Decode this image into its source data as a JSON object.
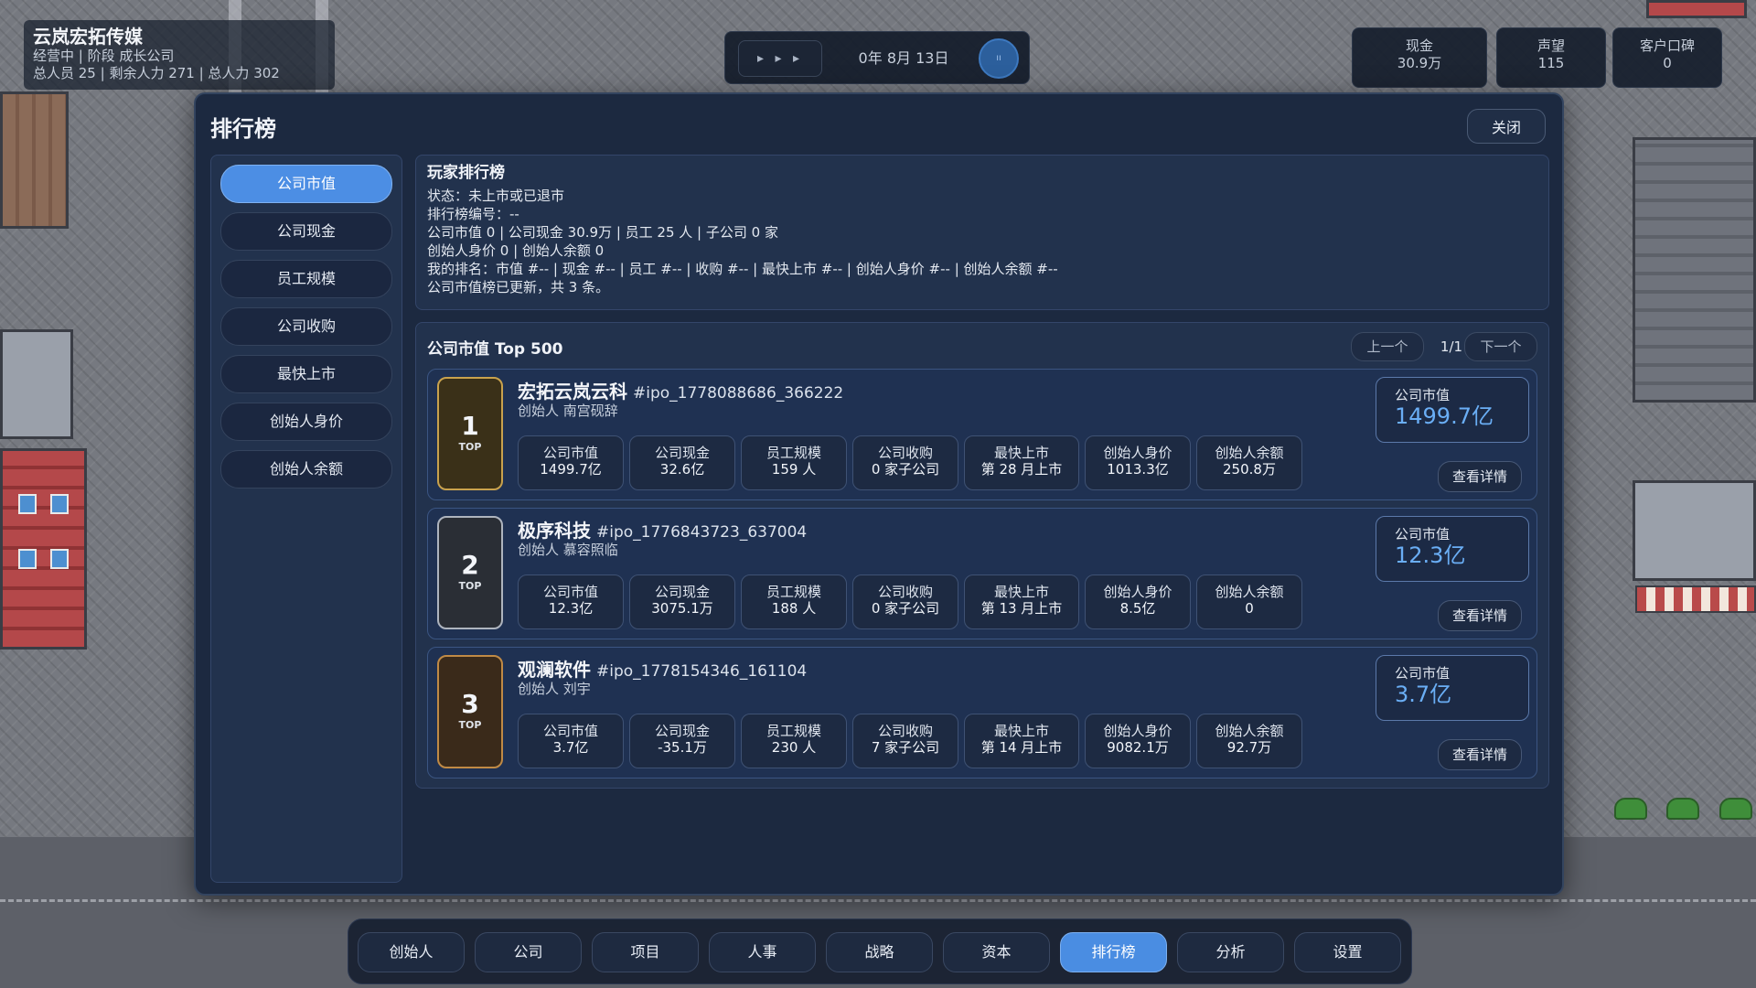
{
  "hud": {
    "company_name": "云岚宏拓传媒",
    "status_line": "经营中 | 阶段 成长公司",
    "staff_line": "总人员 25 | 剩余人力 271 | 总人力 302",
    "speed_label": "▸ ▸ ▸",
    "date": "0年 8月 13日",
    "pause_icon": "ıı",
    "stats": [
      {
        "label": "现金",
        "value": "30.9万"
      },
      {
        "label": "声望",
        "value": "115"
      },
      {
        "label": "客户口碑",
        "value": "0"
      }
    ]
  },
  "modal": {
    "title": "排行榜",
    "close_label": "关闭"
  },
  "sidebar": {
    "items": [
      {
        "label": "公司市值",
        "active": true
      },
      {
        "label": "公司现金",
        "active": false
      },
      {
        "label": "员工规模",
        "active": false
      },
      {
        "label": "公司收购",
        "active": false
      },
      {
        "label": "最快上市",
        "active": false
      },
      {
        "label": "创始人身价",
        "active": false
      },
      {
        "label": "创始人余额",
        "active": false
      }
    ]
  },
  "player_info": {
    "title": "玩家排行榜",
    "lines": [
      "状态：未上市或已退市",
      "排行榜编号：--",
      "公司市值 0 | 公司现金 30.9万 | 员工 25 人 | 子公司 0 家",
      "创始人身价 0 | 创始人余额 0",
      "我的排名：市值 #-- | 现金 #-- | 员工 #-- | 收购 #-- | 最快上市 #-- | 创始人身价 #-- | 创始人余额 #--",
      "公司市值榜已更新，共 3 条。"
    ]
  },
  "leaderboard": {
    "title": "公司市值 Top 500",
    "prev_label": "上一个",
    "page": "1/1",
    "next_label": "下一个",
    "top_label": "TOP",
    "market_value_label": "公司市值",
    "detail_label": "查看详情",
    "entries": [
      {
        "rank": "1",
        "name": "宏拓云岚云科",
        "id": "#ipo_1778088686_366222",
        "founder": "创始人 南宫砚辞",
        "market_value": "1499.7亿",
        "metrics": [
          {
            "label": "公司市值",
            "value": "1499.7亿"
          },
          {
            "label": "公司现金",
            "value": "32.6亿"
          },
          {
            "label": "员工规模",
            "value": "159 人"
          },
          {
            "label": "公司收购",
            "value": "0 家子公司"
          },
          {
            "label": "最快上市",
            "value": "第 28 月上市"
          },
          {
            "label": "创始人身价",
            "value": "1013.3亿"
          },
          {
            "label": "创始人余额",
            "value": "250.8万"
          }
        ]
      },
      {
        "rank": "2",
        "name": "极序科技",
        "id": "#ipo_1776843723_637004",
        "founder": "创始人 慕容照临",
        "market_value": "12.3亿",
        "metrics": [
          {
            "label": "公司市值",
            "value": "12.3亿"
          },
          {
            "label": "公司现金",
            "value": "3075.1万"
          },
          {
            "label": "员工规模",
            "value": "188 人"
          },
          {
            "label": "公司收购",
            "value": "0 家子公司"
          },
          {
            "label": "最快上市",
            "value": "第 13 月上市"
          },
          {
            "label": "创始人身价",
            "value": "8.5亿"
          },
          {
            "label": "创始人余额",
            "value": "0"
          }
        ]
      },
      {
        "rank": "3",
        "name": "观澜软件",
        "id": "#ipo_1778154346_161104",
        "founder": "创始人 刘宇",
        "market_value": "3.7亿",
        "metrics": [
          {
            "label": "公司市值",
            "value": "3.7亿"
          },
          {
            "label": "公司现金",
            "value": "-35.1万"
          },
          {
            "label": "员工规模",
            "value": "230 人"
          },
          {
            "label": "公司收购",
            "value": "7 家子公司"
          },
          {
            "label": "最快上市",
            "value": "第 14 月上市"
          },
          {
            "label": "创始人身价",
            "value": "9082.1万"
          },
          {
            "label": "创始人余额",
            "value": "92.7万"
          }
        ]
      }
    ]
  },
  "bottom_nav": {
    "items": [
      {
        "label": "创始人",
        "active": false
      },
      {
        "label": "公司",
        "active": false
      },
      {
        "label": "项目",
        "active": false
      },
      {
        "label": "人事",
        "active": false
      },
      {
        "label": "战略",
        "active": false
      },
      {
        "label": "资本",
        "active": false
      },
      {
        "label": "排行榜",
        "active": true
      },
      {
        "label": "分析",
        "active": false
      },
      {
        "label": "设置",
        "active": false
      }
    ]
  },
  "colors": {
    "accent": "#4c8ee4",
    "market_value_text": "#6aaef5",
    "panel_bg": "#1c2940"
  }
}
